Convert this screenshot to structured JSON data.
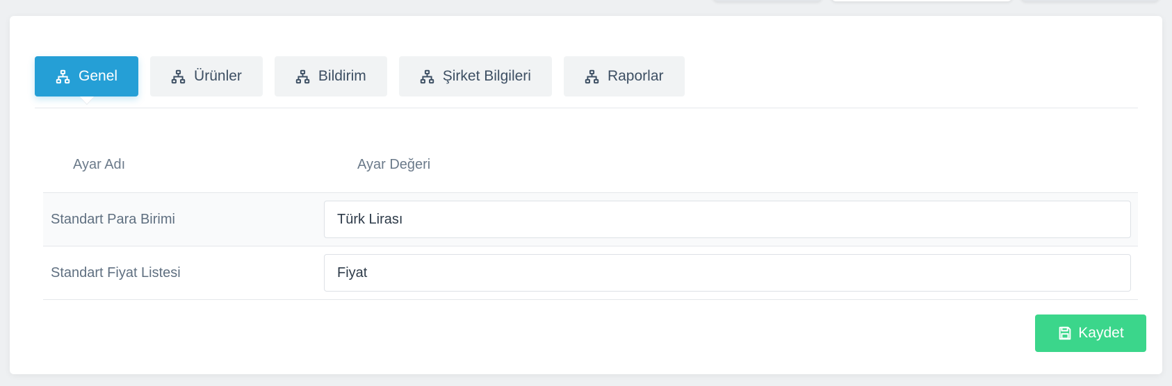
{
  "tabs": [
    {
      "label": "Genel",
      "icon": "sitemap-icon",
      "active": true
    },
    {
      "label": "Ürünler",
      "icon": "sitemap-icon",
      "active": false
    },
    {
      "label": "Bildirim",
      "icon": "sitemap-icon",
      "active": false
    },
    {
      "label": "Şirket Bilgileri",
      "icon": "sitemap-icon",
      "active": false
    },
    {
      "label": "Raporlar",
      "icon": "sitemap-icon",
      "active": false
    }
  ],
  "table": {
    "headers": {
      "name": "Ayar Adı",
      "value": "Ayar Değeri"
    },
    "rows": [
      {
        "name": "Standart Para Birimi",
        "value": "Türk Lirası"
      },
      {
        "name": "Standart Fiyat Listesi",
        "value": "Fiyat"
      }
    ]
  },
  "save_button": {
    "label": "Kaydet",
    "icon": "save-icon"
  },
  "colors": {
    "tab_active": "#259fd6",
    "tab_inactive": "#f1f3f4",
    "save": "#3bd68b"
  }
}
